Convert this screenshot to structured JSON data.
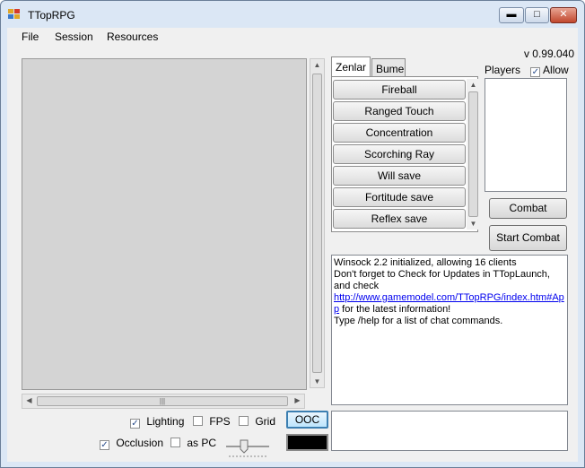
{
  "window": {
    "title": "TTopRPG"
  },
  "menu": {
    "items": [
      "File",
      "Session",
      "Resources"
    ]
  },
  "version": "v 0.99.040",
  "tabs": [
    "Zenlar",
    "Bume"
  ],
  "spells": [
    "Fireball",
    "Ranged Touch",
    "Concentration",
    "Scorching Ray",
    "Will save",
    "Fortitude save",
    "Reflex save"
  ],
  "players": {
    "label": "Players",
    "allow_label": "Allow",
    "allow_checked": true
  },
  "buttons": {
    "combat": "Combat",
    "start_combat": "Start Combat",
    "ooc": "OOC"
  },
  "chat": {
    "line1": "Winsock 2.2 initialized, allowing 16 clients",
    "line2": "Don't forget to Check for Updates in TTopLaunch, and check",
    "link": "http://www.gamemodel.com/TTopRPG/index.htm#App",
    "line3": " for the latest information!",
    "line4": "Type /help for a list of chat commands."
  },
  "options": {
    "lighting": {
      "label": "Lighting",
      "checked": true
    },
    "fps": {
      "label": "FPS",
      "checked": false
    },
    "grid": {
      "label": "Grid",
      "checked": false
    },
    "occlusion": {
      "label": "Occlusion",
      "checked": true
    },
    "as_pc": {
      "label": "as PC",
      "checked": false
    }
  },
  "colors": {
    "title_bg": "#dbe7f5",
    "close_btn": "#c1472d",
    "link": "#0000ee",
    "chat_color": "#000000"
  }
}
